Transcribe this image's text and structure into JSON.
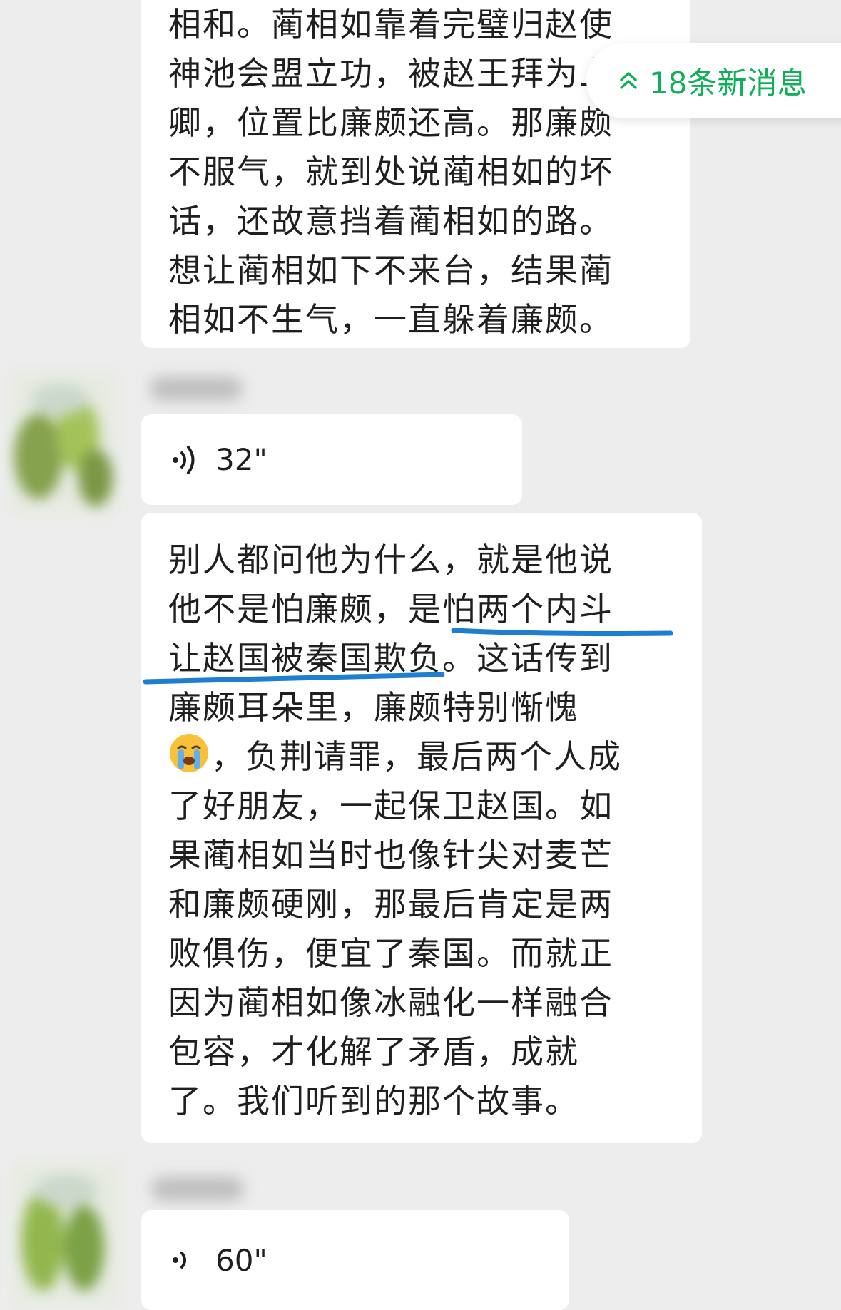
{
  "new_messages": {
    "label": "18条新消息",
    "color": "#10b05a"
  },
  "messages": {
    "text1": {
      "lines": [
        "相和。蔺相如靠着完璧归赵使",
        "神池会盟立功，被赵王拜为上",
        "卿，位置比廉颇还高。那廉颇",
        "不服气，就到处说蔺相如的坏",
        "话，还故意挡着蔺相如的路。",
        "想让蔺相如下不来台，结果蔺",
        "相如不生气，一直躲着廉颇。"
      ]
    },
    "voice1": {
      "duration": "32\"",
      "icon": "voice-wave-icon"
    },
    "text2": {
      "lines": [
        "别人都问他为什么，就是他说",
        "他不是怕廉颇，是怕两个内斗",
        "让赵国被秦国欺负。这话传到",
        "廉颇耳朵里，廉颇特别惭愧",
        "，负荆请罪，最后两个人成",
        "了好朋友，一起保卫赵国。如",
        "果蔺相如当时也像针尖对麦芒",
        "和廉颇硬刚，那最后肯定是两",
        "败俱伤，便宜了秦国。而就正",
        "因为蔺相如像冰融化一样融合",
        "包容，才化解了矛盾，成就",
        "了。我们听到的那个故事。"
      ],
      "emoji": "crying-face-icon",
      "highlight_color": "#1e7ed0"
    },
    "voice2": {
      "duration": "60\"",
      "icon": "voice-wave-icon"
    }
  },
  "colors": {
    "background": "#ededed",
    "bubble": "#ffffff",
    "text": "#1f1f1f"
  }
}
